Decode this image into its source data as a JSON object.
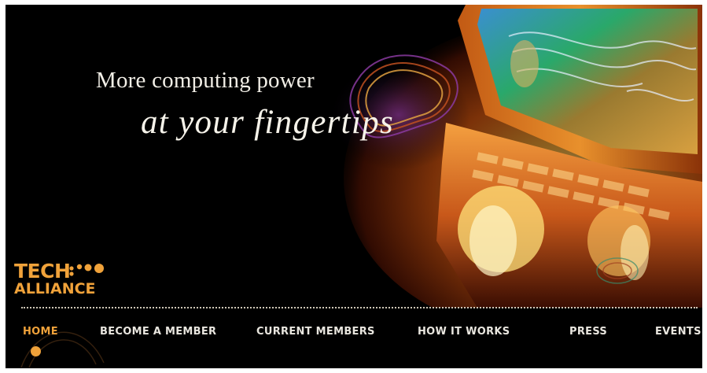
{
  "hero": {
    "tagline_line1": "More computing power",
    "tagline_line2": "at your fingertips"
  },
  "logo": {
    "line1": "TECH",
    "line2": "ALLIANCE"
  },
  "nav": {
    "active_item": "HOME",
    "items": [
      {
        "label": "HOME"
      },
      {
        "label": "BECOME A MEMBER"
      },
      {
        "label": "CURRENT MEMBERS"
      },
      {
        "label": "HOW IT WORKS"
      },
      {
        "label": "PRESS"
      },
      {
        "label": "EVENTS"
      }
    ]
  },
  "colors": {
    "background": "#000000",
    "accent_orange": "#f0a23a",
    "nav_text": "#e9e6df",
    "divider": "#cfc8b8"
  },
  "icons": {
    "active_indicator": "orange-dot-icon",
    "logo_mark": "three-dots-icon"
  }
}
